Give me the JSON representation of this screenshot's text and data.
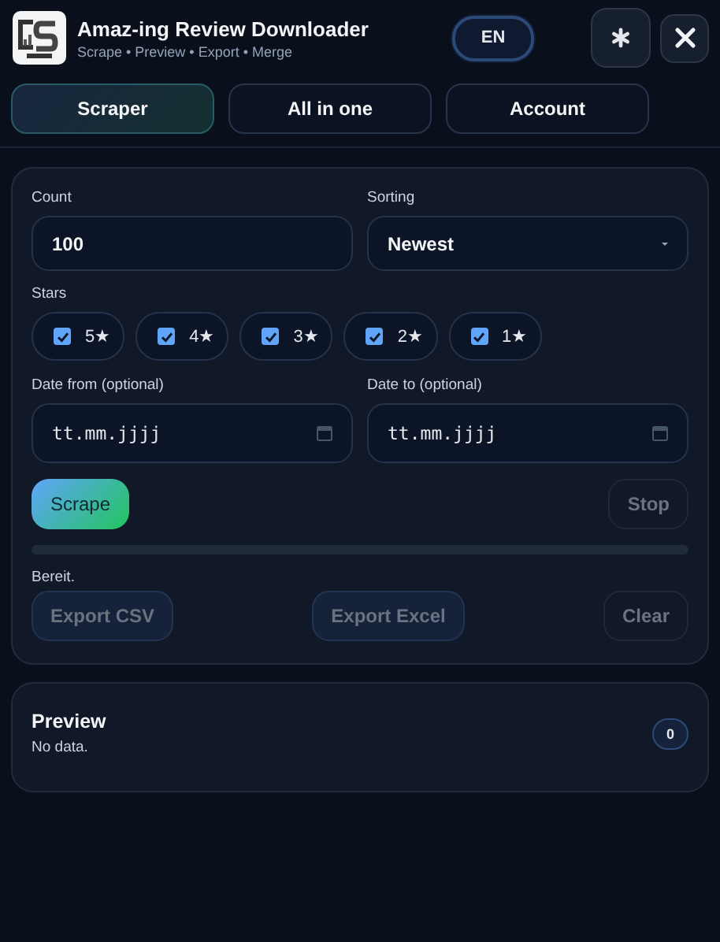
{
  "header": {
    "title": "Amaz-ing Review Downloader",
    "subtitle": "Scrape • Preview • Export • Merge",
    "language": "EN"
  },
  "tabs": [
    {
      "label": "Scraper",
      "selected": true
    },
    {
      "label": "All in one",
      "selected": false
    },
    {
      "label": "Account",
      "selected": false
    }
  ],
  "form": {
    "count": {
      "label": "Count",
      "value": "100"
    },
    "sorting": {
      "label": "Sorting",
      "value": "Newest"
    },
    "stars": {
      "label": "Stars",
      "options": [
        {
          "label": "5★",
          "checked": true
        },
        {
          "label": "4★",
          "checked": true
        },
        {
          "label": "3★",
          "checked": true
        },
        {
          "label": "2★",
          "checked": true
        },
        {
          "label": "1★",
          "checked": true
        }
      ]
    },
    "date_from": {
      "label": "Date from (optional)",
      "placeholder": "tt.mm.jjjj"
    },
    "date_to": {
      "label": "Date to (optional)",
      "placeholder": "tt.mm.jjjj"
    }
  },
  "run_buttons": [
    {
      "label": "Scrape",
      "kind": "primary",
      "disabled": false
    },
    {
      "label": "Stop",
      "kind": "plain",
      "disabled": true
    }
  ],
  "progress": {
    "level": 0
  },
  "status": "Bereit.",
  "export_buttons": [
    {
      "label": "Export CSV",
      "kind": "outline",
      "disabled": true
    },
    {
      "label": "Export Excel",
      "kind": "outline",
      "disabled": true
    },
    {
      "label": "Clear",
      "kind": "plain",
      "disabled": true
    }
  ],
  "preview": {
    "title": "Preview",
    "message": "No data.",
    "count": "0"
  }
}
